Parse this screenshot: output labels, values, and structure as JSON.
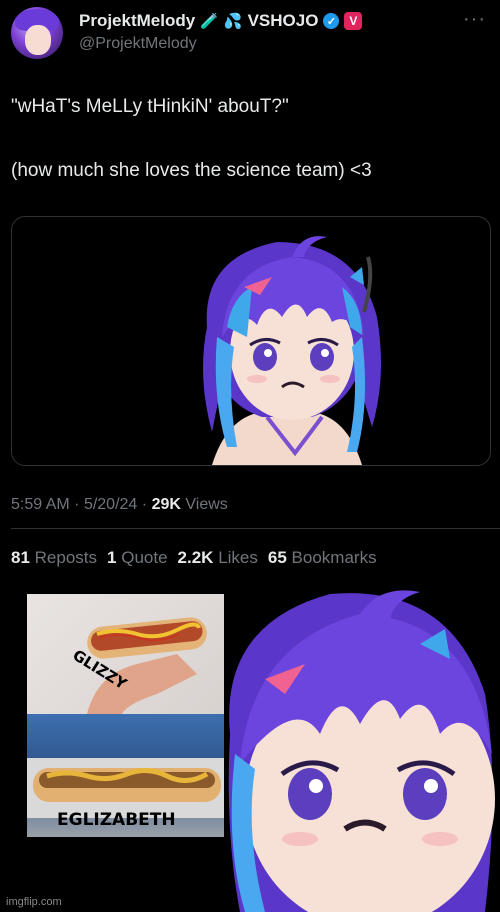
{
  "tweet": {
    "display_name": "ProjektMelody",
    "name_emojis": [
      "🧪",
      "💦"
    ],
    "affiliation": "VSHOJO",
    "verified_badge": "✓",
    "affiliate_badge": "V",
    "handle": "@ProjektMelody",
    "more_menu": "···",
    "text_line1": "\"wHaT's MeLLy tHinkiN' abouT?\"",
    "text_line2": "(how much she loves the science team) <3",
    "time": "5:59 AM",
    "sep": "·",
    "date": "5/20/24",
    "views_count": "29K",
    "views_label": "Views",
    "reposts_count": "81",
    "reposts_label": "Reposts",
    "quotes_count": "1",
    "quotes_label": "Quote",
    "likes_count": "2.2K",
    "likes_label": "Likes",
    "bookmarks_count": "65",
    "bookmarks_label": "Bookmarks"
  },
  "meme": {
    "top_caption": "GLIZZY",
    "bottom_caption": "EGLIZABETH"
  },
  "watermark": "imgflip.com",
  "colors": {
    "background": "#000000",
    "text_primary": "#e7e9ea",
    "text_secondary": "#71767b",
    "verified_blue": "#1d9bf0",
    "vshojo_pink": "#e0245e"
  }
}
